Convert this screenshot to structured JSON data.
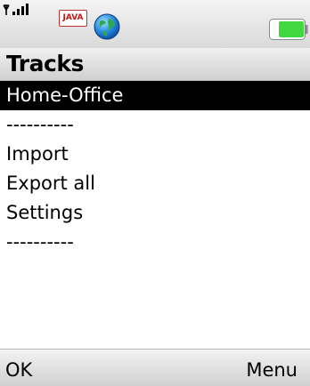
{
  "status_bar": {
    "java_badge": "JAVA",
    "signal_icon": "signal-strength-icon",
    "globe_icon": "globe-icon",
    "battery_icon": "battery-icon"
  },
  "title": "Tracks",
  "list": {
    "items": [
      {
        "label": "Home-Office",
        "selected": true
      },
      {
        "label": "----------",
        "selected": false
      },
      {
        "label": "Import",
        "selected": false
      },
      {
        "label": "Export all",
        "selected": false
      },
      {
        "label": "Settings",
        "selected": false
      },
      {
        "label": "----------",
        "selected": false
      }
    ]
  },
  "softkeys": {
    "left": "OK",
    "right": "Menu"
  },
  "colors": {
    "selection_bg": "#000000",
    "selection_fg": "#ffffff",
    "battery_green": "#3fd93f"
  }
}
